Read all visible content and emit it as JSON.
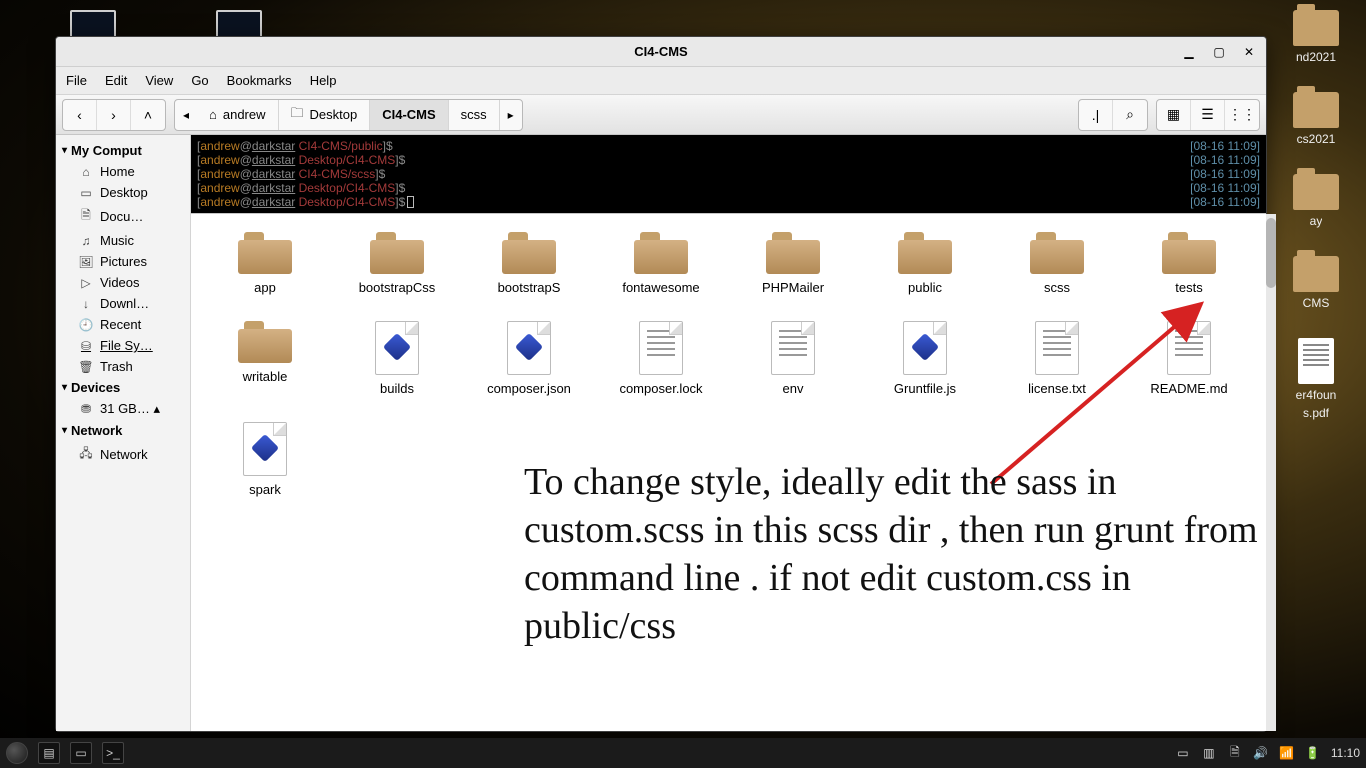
{
  "window": {
    "title": "CI4-CMS",
    "menubar": [
      "File",
      "Edit",
      "View",
      "Go",
      "Bookmarks",
      "Help"
    ],
    "nav": {
      "back": "‹",
      "forward": "›",
      "up": "˄"
    },
    "path": {
      "leading_arrow": "◂",
      "segments": [
        {
          "icon": "home",
          "label": "andrew"
        },
        {
          "icon": "folder",
          "label": "Desktop"
        },
        {
          "icon": "",
          "label": "CI4-CMS",
          "active": true
        },
        {
          "icon": "",
          "label": "scss"
        }
      ],
      "trailing_arrow": "▸"
    },
    "toolbar_right": {
      "toggle_path": ".|",
      "search": "⌕",
      "view_icons": "▦",
      "view_list": "☰",
      "view_compact": "⋮⋮"
    },
    "controls": {
      "min": "▁",
      "max": "▢",
      "close": "✕"
    }
  },
  "sidebar": {
    "sections": [
      {
        "head": "My Comput",
        "items": [
          {
            "icon": "⌂",
            "label": "Home"
          },
          {
            "icon": "▭",
            "label": "Desktop"
          },
          {
            "icon": "🗎",
            "label": "Docu…"
          },
          {
            "icon": "♫",
            "label": "Music"
          },
          {
            "icon": "🖼",
            "label": "Pictures"
          },
          {
            "icon": "▷",
            "label": "Videos"
          },
          {
            "icon": "↓",
            "label": "Downl…"
          },
          {
            "icon": "🕘",
            "label": "Recent"
          },
          {
            "icon": "⛁",
            "label": "File Sy…",
            "sel": true
          },
          {
            "icon": "🗑",
            "label": "Trash"
          }
        ]
      },
      {
        "head": "Devices",
        "items": [
          {
            "icon": "⛃",
            "label": "31 GB… ▴"
          }
        ]
      },
      {
        "head": "Network",
        "items": [
          {
            "icon": "🖧",
            "label": "Network"
          }
        ]
      }
    ]
  },
  "terminal": {
    "lines": [
      {
        "user": "andrew",
        "host": "darkstar",
        "path": "CI4-CMS/public",
        "time": "[08-16 11:09]"
      },
      {
        "user": "andrew",
        "host": "darkstar",
        "path": "Desktop/CI4-CMS",
        "time": "[08-16 11:09]"
      },
      {
        "user": "andrew",
        "host": "darkstar",
        "path": "CI4-CMS/scss",
        "time": "[08-16 11:09]"
      },
      {
        "user": "andrew",
        "host": "darkstar",
        "path": "Desktop/CI4-CMS",
        "time": "[08-16 11:09]"
      },
      {
        "user": "andrew",
        "host": "darkstar",
        "path": "Desktop/CI4-CMS",
        "time": "[08-16 11:09]",
        "cursor": true
      }
    ]
  },
  "files": [
    {
      "name": "app",
      "type": "folder"
    },
    {
      "name": "bootstrapCss",
      "type": "folder"
    },
    {
      "name": "bootstrapS",
      "type": "folder"
    },
    {
      "name": "fontawesome",
      "type": "folder"
    },
    {
      "name": "PHPMailer",
      "type": "folder"
    },
    {
      "name": "public",
      "type": "folder"
    },
    {
      "name": "scss",
      "type": "folder"
    },
    {
      "name": "tests",
      "type": "folder"
    },
    {
      "name": "writable",
      "type": "folder"
    },
    {
      "name": "builds",
      "type": "gem"
    },
    {
      "name": "composer.json",
      "type": "gem"
    },
    {
      "name": "composer.lock",
      "type": "doc"
    },
    {
      "name": "env",
      "type": "doc"
    },
    {
      "name": "Gruntfile.js",
      "type": "gem"
    },
    {
      "name": "license.txt",
      "type": "doc"
    },
    {
      "name": "README.md",
      "type": "doc"
    },
    {
      "name": "spark",
      "type": "gem"
    }
  ],
  "overlay_note": "To change style, ideally edit the sass in custom.scss in this scss dir , then run grunt from command line . if not edit custom.css in public/css",
  "desktop_icons": [
    {
      "label": "nd2021",
      "type": "folder"
    },
    {
      "label": "cs2021",
      "type": "folder"
    },
    {
      "label": "ay",
      "type": "folder"
    },
    {
      "label": "CMS",
      "type": "folder"
    },
    {
      "label": "er4foun",
      "sub": "s.pdf",
      "type": "file"
    }
  ],
  "taskbar": {
    "clock": "11:10",
    "tray": [
      "▭",
      "▥",
      "🗎",
      "🔊",
      "📶",
      "🔋"
    ]
  }
}
